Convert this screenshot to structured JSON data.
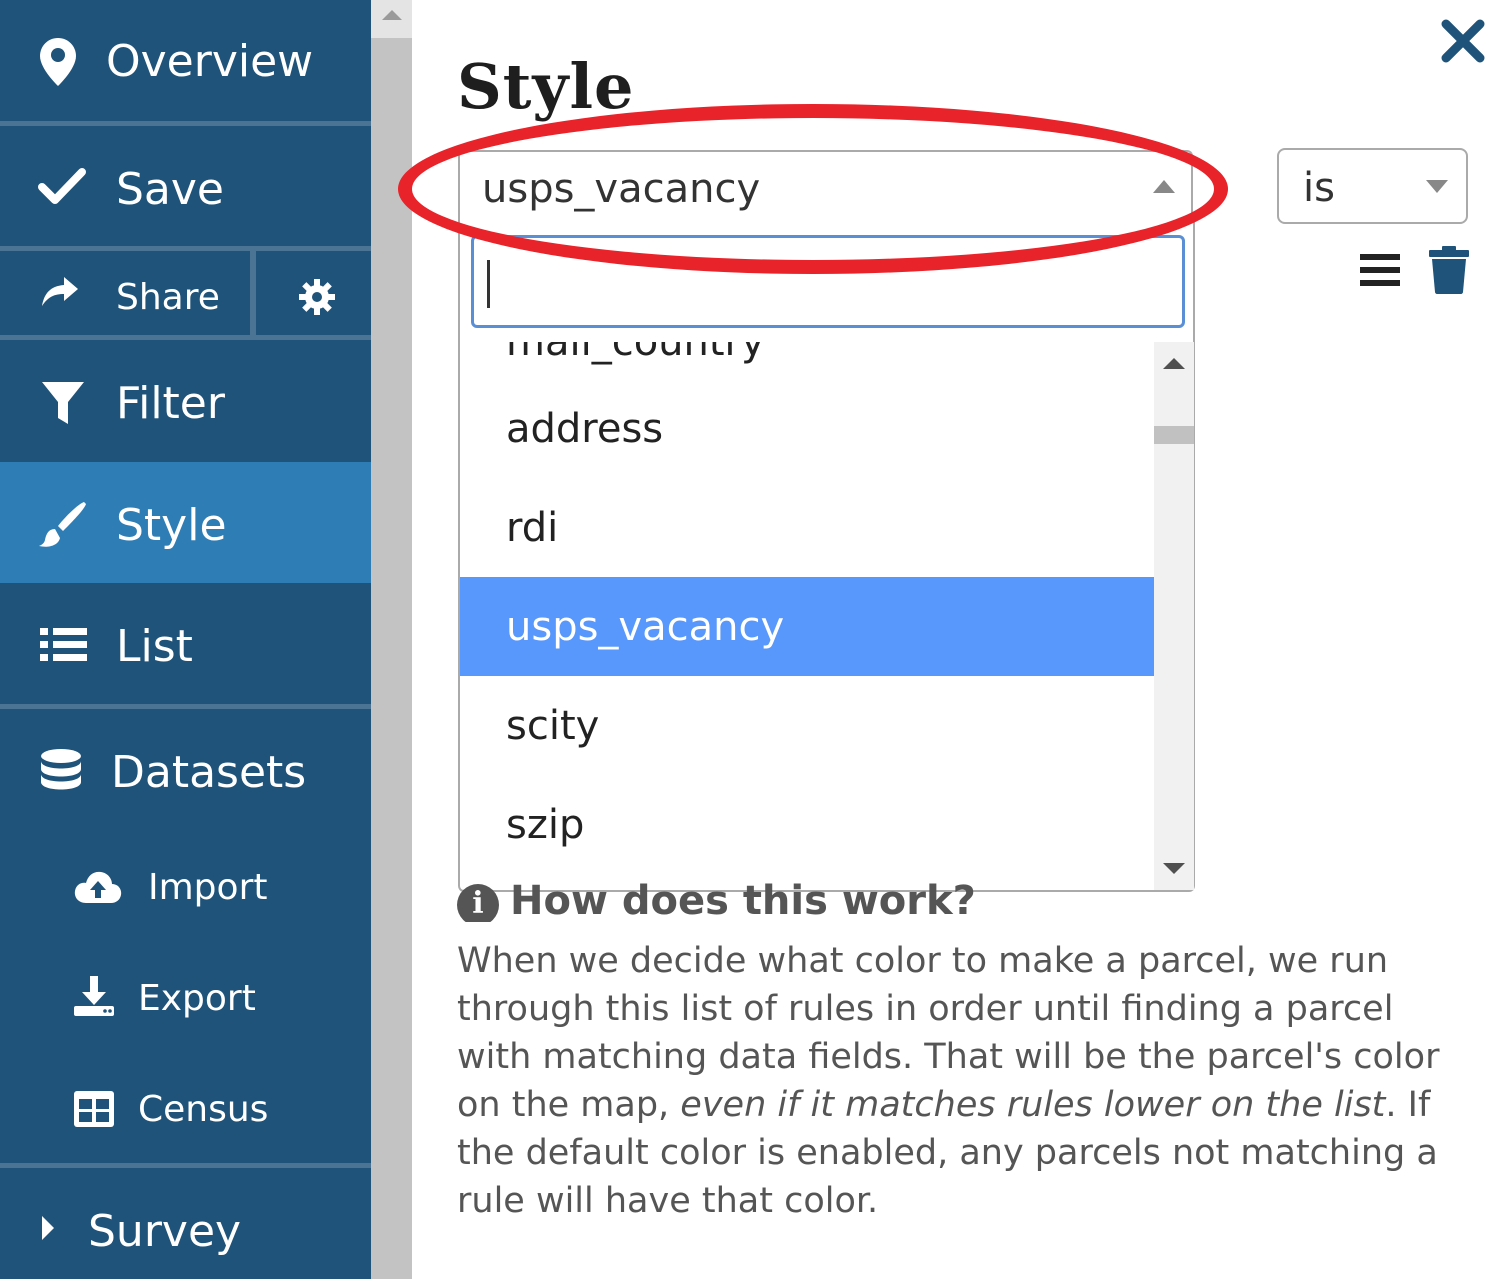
{
  "sidebar": {
    "items": [
      {
        "label": "Overview",
        "icon": "map-marker-icon"
      },
      {
        "label": "Save",
        "icon": "checkmark-icon"
      },
      {
        "label": "Share",
        "icon": "share-icon"
      },
      {
        "label": "Filter",
        "icon": "filter-icon"
      },
      {
        "label": "Style",
        "icon": "paintbrush-icon"
      },
      {
        "label": "List",
        "icon": "list-icon"
      },
      {
        "label": "Datasets",
        "icon": "database-icon"
      },
      {
        "label": "Import",
        "icon": "cloud-upload-icon"
      },
      {
        "label": "Export",
        "icon": "download-icon"
      },
      {
        "label": "Census",
        "icon": "table-icon"
      },
      {
        "label": "Survey",
        "icon": "caret-right-icon"
      }
    ],
    "active": "Style",
    "settings_icon": "gear-icon"
  },
  "panel": {
    "title": "Style",
    "field_select": {
      "value": "usps_vacancy",
      "search_value": "",
      "options": [
        "mail_country",
        "address",
        "rdi",
        "usps_vacancy",
        "scity",
        "szip"
      ],
      "selected": "usps_vacancy"
    },
    "operator_select": {
      "value": "is"
    },
    "help": {
      "heading": "How does this work?",
      "body_part1": "When we decide what color to make a parcel, we run through this list of rules in order until finding a parcel with matching data fields. That will be the parcel's color on the map, ",
      "body_emphasis": "even if it matches rules lower on the list",
      "body_part2": ". If the default color is enabled, any parcels not matching a rule will have that color."
    }
  },
  "colors": {
    "sidebar_bg": "#1f5379",
    "sidebar_active": "#2e7db5",
    "selected_option": "#5897fb",
    "annotation": "#e8232a"
  }
}
